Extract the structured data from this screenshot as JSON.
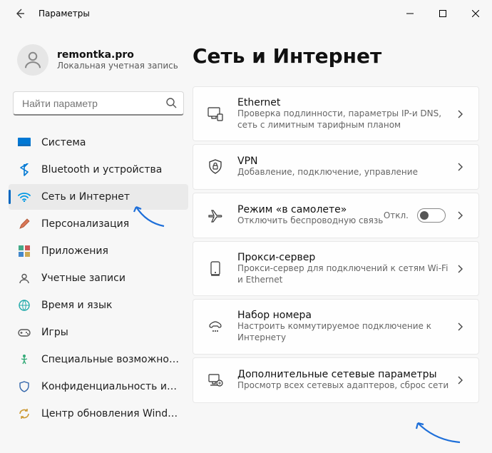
{
  "window": {
    "title": "Параметры"
  },
  "account": {
    "name": "remontka.pro",
    "type": "Локальная учетная запись"
  },
  "search": {
    "placeholder": "Найти параметр"
  },
  "sidebar": {
    "items": [
      {
        "id": "system",
        "label": "Система",
        "active": false
      },
      {
        "id": "bluetooth",
        "label": "Bluetooth и устройства",
        "active": false
      },
      {
        "id": "network",
        "label": "Сеть и Интернет",
        "active": true
      },
      {
        "id": "personalization",
        "label": "Персонализация",
        "active": false
      },
      {
        "id": "apps",
        "label": "Приложения",
        "active": false
      },
      {
        "id": "accounts",
        "label": "Учетные записи",
        "active": false
      },
      {
        "id": "time",
        "label": "Время и язык",
        "active": false
      },
      {
        "id": "gaming",
        "label": "Игры",
        "active": false
      },
      {
        "id": "accessibility",
        "label": "Специальные возможности",
        "active": false
      },
      {
        "id": "privacy",
        "label": "Конфиденциальность и безопасность",
        "active": false
      },
      {
        "id": "update",
        "label": "Центр обновления Windows",
        "active": false
      }
    ]
  },
  "page": {
    "title": "Сеть и Интернет"
  },
  "cards": [
    {
      "id": "ethernet",
      "title": "Ethernet",
      "sub": "Проверка подлинности, параметры IP-и DNS, сеть с лимитным тарифным планом"
    },
    {
      "id": "vpn",
      "title": "VPN",
      "sub": "Добавление, подключение, управление"
    },
    {
      "id": "airplane",
      "title": "Режим «в самолете»",
      "sub": "Отключить беспроводную связь",
      "toggle": {
        "state": "off",
        "label": "Откл."
      }
    },
    {
      "id": "proxy",
      "title": "Прокси-сервер",
      "sub": "Прокси-сервер для подключений к сетям Wi-Fi и Ethernet"
    },
    {
      "id": "dialup",
      "title": "Набор номера",
      "sub": "Настроить коммутируемое подключение к Интернету"
    },
    {
      "id": "advanced",
      "title": "Дополнительные сетевые параметры",
      "sub": "Просмотр всех сетевых адаптеров, сброс сети"
    }
  ]
}
